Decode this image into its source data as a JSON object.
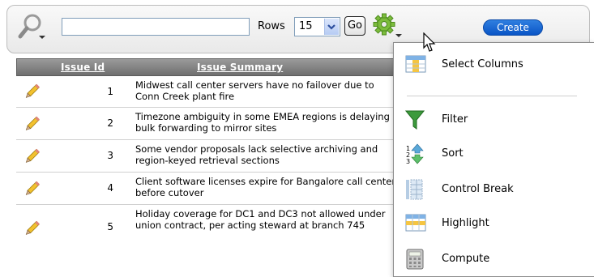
{
  "toolbar": {
    "search_value": "",
    "rows_label": "Rows",
    "rows_value": "15",
    "go_label": "Go",
    "create_label": "Create"
  },
  "table": {
    "columns": [
      "Issue Id",
      "Issue Summary"
    ],
    "rows": [
      {
        "id": "1",
        "summary": "Midwest call center servers have no failover due to Conn Creek plant fire"
      },
      {
        "id": "2",
        "summary": "Timezone ambiguity in some EMEA regions is delaying bulk forwarding to mirror sites"
      },
      {
        "id": "3",
        "summary": "Some vendor proposals lack selective archiving and region-keyed retrieval sections"
      },
      {
        "id": "4",
        "summary": "Client software licenses expire for Bangalore call center before cutover"
      },
      {
        "id": "5",
        "summary": "Holiday coverage for DC1 and DC3 not allowed under union contract, per acting steward at branch 745"
      }
    ]
  },
  "actions_menu": {
    "items": [
      {
        "label": "Select Columns",
        "icon": "select-columns-icon"
      },
      {
        "label": "Filter",
        "icon": "funnel-icon"
      },
      {
        "label": "Sort",
        "icon": "sort-icon"
      },
      {
        "label": "Control Break",
        "icon": "control-break-icon"
      },
      {
        "label": "Highlight",
        "icon": "highlight-icon"
      },
      {
        "label": "Compute",
        "icon": "calculator-icon"
      }
    ]
  },
  "colors": {
    "create_button": "#0a55c6",
    "header_bg": "#7a7a7a",
    "filter_icon": "#2e8b2e"
  }
}
